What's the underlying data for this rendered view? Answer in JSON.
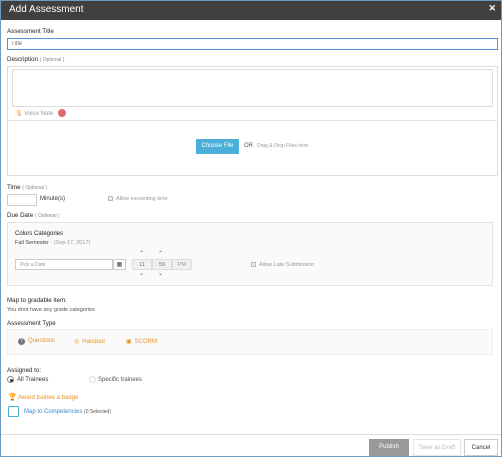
{
  "dialog": {
    "title": "Add Assessment",
    "close_icon": "close-icon"
  },
  "title_field": {
    "label": "Assessment Title",
    "placeholder": "Title"
  },
  "description": {
    "label": "Description",
    "optional": "( Optional )",
    "voice_note": "Voice Note"
  },
  "upload": {
    "button": "Choose File",
    "or": "OR",
    "hint": "Drag & Drop Files here"
  },
  "time": {
    "label": "Time",
    "optional": "( Optional )",
    "unit": "Minute(s)",
    "allow_exceeding": "Allow exceeding time"
  },
  "due_date": {
    "label": "Due Date",
    "optional": "( Optional )",
    "category_title": "Colors Categories",
    "semester": "Fall Semester",
    "semester_date": "- (Sep 17, 2017)",
    "date_placeholder": "Pick a Date",
    "hour": "11",
    "minute": "59",
    "ampm": "PM",
    "late_submission": "Allow Late Submission"
  },
  "gradable": {
    "label": "Map to gradable item:",
    "note": "You dont have any grade categories"
  },
  "assessment_type": {
    "label": "Assessment Type",
    "options": [
      "Questions",
      "Handout",
      "SCORM"
    ]
  },
  "assigned": {
    "label": "Assigned to:",
    "all": "All Trainees",
    "specific": "Specific trainees",
    "selected": "All Trainees"
  },
  "badge": {
    "label": "Award trainee a badge"
  },
  "competencies": {
    "label": "Map to Competencies",
    "count": "(0 Selected)"
  },
  "footer": {
    "publish": "Publish",
    "draft": "Save as Draft",
    "cancel": "Cancel"
  },
  "colors": {
    "accent": "#4ab0d9",
    "orange": "#e8922b",
    "titlebar": "#404040",
    "green": "#3c9a3c"
  }
}
